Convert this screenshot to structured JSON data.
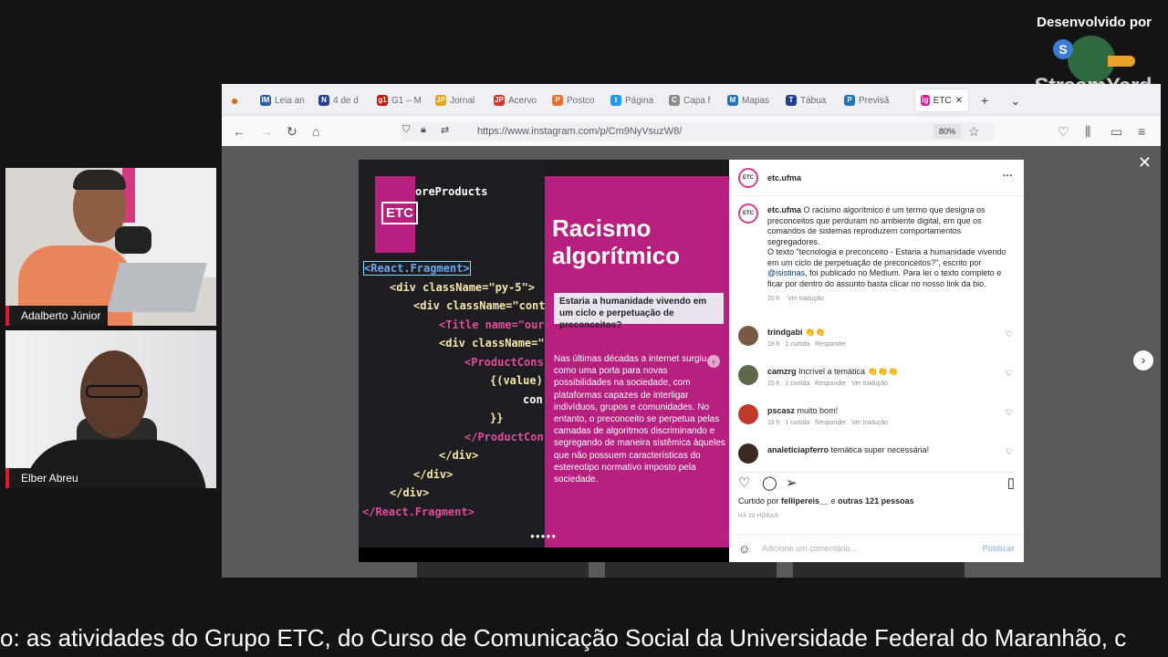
{
  "brand": {
    "developed_by": "Desenvolvido por",
    "name": "StreamYard"
  },
  "participants": [
    {
      "name": "Adalberto Júnior"
    },
    {
      "name": "Elber Abreu"
    }
  ],
  "browser": {
    "tabs": [
      {
        "label": "Leia an",
        "fav": "IM",
        "color": "#2a5ea8"
      },
      {
        "label": "4 de d",
        "fav": "N",
        "color": "#25408f"
      },
      {
        "label": "G1 – M",
        "fav": "g1",
        "color": "#c4170c"
      },
      {
        "label": "Jornal",
        "fav": "JP",
        "color": "#e3a21a"
      },
      {
        "label": "Acervo",
        "fav": "JP",
        "color": "#d4362a"
      },
      {
        "label": "Postco",
        "fav": "P",
        "color": "#ec6d2d"
      },
      {
        "label": "Página",
        "fav": "t",
        "color": "#1d9bf0"
      },
      {
        "label": "Capa f",
        "fav": "C",
        "color": "#8a8a8a"
      },
      {
        "label": "Mapas",
        "fav": "M",
        "color": "#1f73b7"
      },
      {
        "label": "Tábua",
        "fav": "T",
        "color": "#1d3f8f"
      },
      {
        "label": "Previsã",
        "fav": "P",
        "color": "#1f73b7"
      },
      {
        "label": "ETC",
        "fav": "ig",
        "color": "#d6249f"
      }
    ],
    "url": "https://www.instagram.com/p/Cm9NyVsuzW8/",
    "zoom": "80%"
  },
  "post": {
    "image": {
      "code_header": "oreProducts",
      "code_lines": [
        "<React.Fragment>",
        "<div className=\"py-5\">",
        "<div className=\"cont",
        "<Title name=\"our",
        "<div className=\"",
        "<ProductCons",
        "{(value)",
        "con",
        "}}",
        "</ProductCon",
        "</div>",
        "</div>",
        "</div>",
        "</React.Fragment>"
      ],
      "logo": "ETC",
      "title_line1": "Racismo",
      "title_line2": "algorítmico",
      "subtitle": "Estaria a humanidade vivendo em um ciclo e perpetuação de preconceitos?",
      "body": "Nas últimas décadas a internet surgiu como uma porta para novas possibilidades na sociedade, com plataformas capazes de interligar indivíduos, grupos e comunidades. No entanto, o preconceito se perpetua pelas camadas de algoritmos discriminando e segregando de maneira sistêmica àqueles que não possuem características do estereotipo normativo imposto pela sociedade."
    },
    "account": "etc.ufma",
    "more": "···",
    "caption_user": "etc.ufma",
    "caption_p1": "O racismo algorítmico é um termo que designa os preconceitos que perduram no ambiente digital, em que os comandos de sistemas reproduzem comportamentos segregadores.",
    "caption_p2a": "O texto \"tecnologia e preconceito - Estaria a humanidade vivendo em um ciclo de perpetuação de preconceitos?\", escrito por ",
    "caption_mention": "@isistinas",
    "caption_p2b": ", foi publicado no Medium. Para ler o texto completo e ficar por dentro do assunto basta clicar no nosso link da bio.",
    "caption_time": "20 h",
    "caption_translate": "Ver tradução",
    "comments": [
      {
        "user": "trindgabi",
        "text": "👏👏",
        "meta": "18 h   1 curtida   Responder",
        "avatar": "#7a5a45"
      },
      {
        "user": "camzrg",
        "text": "Incrível a temática 👏👏👏",
        "meta": "15 h   1 curtida   Responder   Ver tradução",
        "avatar": "#5d6b4a"
      },
      {
        "user": "pscasz",
        "text": "muito bom!",
        "meta": "19 h   1 curtida   Responder   Ver tradução",
        "avatar": "#c0392b"
      },
      {
        "user": "analeticiapferro",
        "text": "temática super necessária!",
        "meta": "",
        "avatar": "#3a2a22"
      }
    ],
    "likes_prefix": "Curtido por ",
    "likes_user": "fellipereis__",
    "likes_mid": " e ",
    "likes_others": "outras 121 pessoas",
    "posted_ago": "HÁ 20 HORAS",
    "comment_placeholder": "Adicione um comentário...",
    "publish_label": "Publicar"
  },
  "ticker": "o: as atividades do Grupo ETC, do Curso de Comunicação Social da Universidade Federal do Maranhão, c"
}
